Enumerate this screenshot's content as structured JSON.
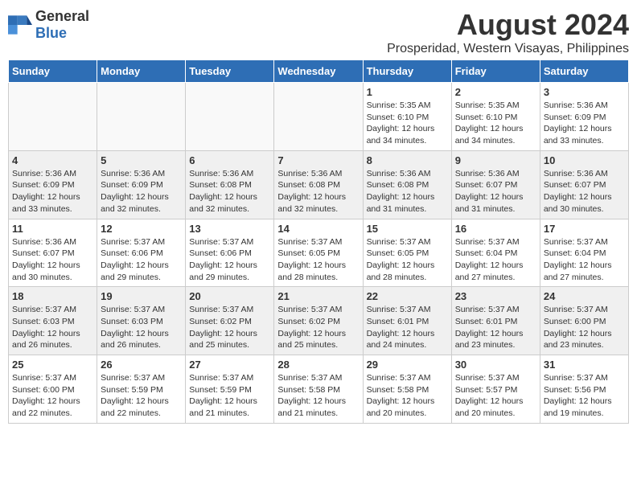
{
  "logo": {
    "text_general": "General",
    "text_blue": "Blue"
  },
  "title": "August 2024",
  "subtitle": "Prosperidad, Western Visayas, Philippines",
  "days_of_week": [
    "Sunday",
    "Monday",
    "Tuesday",
    "Wednesday",
    "Thursday",
    "Friday",
    "Saturday"
  ],
  "weeks": [
    [
      {
        "day": "",
        "info": ""
      },
      {
        "day": "",
        "info": ""
      },
      {
        "day": "",
        "info": ""
      },
      {
        "day": "",
        "info": ""
      },
      {
        "day": "1",
        "info": "Sunrise: 5:35 AM\nSunset: 6:10 PM\nDaylight: 12 hours\nand 34 minutes."
      },
      {
        "day": "2",
        "info": "Sunrise: 5:35 AM\nSunset: 6:10 PM\nDaylight: 12 hours\nand 34 minutes."
      },
      {
        "day": "3",
        "info": "Sunrise: 5:36 AM\nSunset: 6:09 PM\nDaylight: 12 hours\nand 33 minutes."
      }
    ],
    [
      {
        "day": "4",
        "info": "Sunrise: 5:36 AM\nSunset: 6:09 PM\nDaylight: 12 hours\nand 33 minutes."
      },
      {
        "day": "5",
        "info": "Sunrise: 5:36 AM\nSunset: 6:09 PM\nDaylight: 12 hours\nand 32 minutes."
      },
      {
        "day": "6",
        "info": "Sunrise: 5:36 AM\nSunset: 6:08 PM\nDaylight: 12 hours\nand 32 minutes."
      },
      {
        "day": "7",
        "info": "Sunrise: 5:36 AM\nSunset: 6:08 PM\nDaylight: 12 hours\nand 32 minutes."
      },
      {
        "day": "8",
        "info": "Sunrise: 5:36 AM\nSunset: 6:08 PM\nDaylight: 12 hours\nand 31 minutes."
      },
      {
        "day": "9",
        "info": "Sunrise: 5:36 AM\nSunset: 6:07 PM\nDaylight: 12 hours\nand 31 minutes."
      },
      {
        "day": "10",
        "info": "Sunrise: 5:36 AM\nSunset: 6:07 PM\nDaylight: 12 hours\nand 30 minutes."
      }
    ],
    [
      {
        "day": "11",
        "info": "Sunrise: 5:36 AM\nSunset: 6:07 PM\nDaylight: 12 hours\nand 30 minutes."
      },
      {
        "day": "12",
        "info": "Sunrise: 5:37 AM\nSunset: 6:06 PM\nDaylight: 12 hours\nand 29 minutes."
      },
      {
        "day": "13",
        "info": "Sunrise: 5:37 AM\nSunset: 6:06 PM\nDaylight: 12 hours\nand 29 minutes."
      },
      {
        "day": "14",
        "info": "Sunrise: 5:37 AM\nSunset: 6:05 PM\nDaylight: 12 hours\nand 28 minutes."
      },
      {
        "day": "15",
        "info": "Sunrise: 5:37 AM\nSunset: 6:05 PM\nDaylight: 12 hours\nand 28 minutes."
      },
      {
        "day": "16",
        "info": "Sunrise: 5:37 AM\nSunset: 6:04 PM\nDaylight: 12 hours\nand 27 minutes."
      },
      {
        "day": "17",
        "info": "Sunrise: 5:37 AM\nSunset: 6:04 PM\nDaylight: 12 hours\nand 27 minutes."
      }
    ],
    [
      {
        "day": "18",
        "info": "Sunrise: 5:37 AM\nSunset: 6:03 PM\nDaylight: 12 hours\nand 26 minutes."
      },
      {
        "day": "19",
        "info": "Sunrise: 5:37 AM\nSunset: 6:03 PM\nDaylight: 12 hours\nand 26 minutes."
      },
      {
        "day": "20",
        "info": "Sunrise: 5:37 AM\nSunset: 6:02 PM\nDaylight: 12 hours\nand 25 minutes."
      },
      {
        "day": "21",
        "info": "Sunrise: 5:37 AM\nSunset: 6:02 PM\nDaylight: 12 hours\nand 25 minutes."
      },
      {
        "day": "22",
        "info": "Sunrise: 5:37 AM\nSunset: 6:01 PM\nDaylight: 12 hours\nand 24 minutes."
      },
      {
        "day": "23",
        "info": "Sunrise: 5:37 AM\nSunset: 6:01 PM\nDaylight: 12 hours\nand 23 minutes."
      },
      {
        "day": "24",
        "info": "Sunrise: 5:37 AM\nSunset: 6:00 PM\nDaylight: 12 hours\nand 23 minutes."
      }
    ],
    [
      {
        "day": "25",
        "info": "Sunrise: 5:37 AM\nSunset: 6:00 PM\nDaylight: 12 hours\nand 22 minutes."
      },
      {
        "day": "26",
        "info": "Sunrise: 5:37 AM\nSunset: 5:59 PM\nDaylight: 12 hours\nand 22 minutes."
      },
      {
        "day": "27",
        "info": "Sunrise: 5:37 AM\nSunset: 5:59 PM\nDaylight: 12 hours\nand 21 minutes."
      },
      {
        "day": "28",
        "info": "Sunrise: 5:37 AM\nSunset: 5:58 PM\nDaylight: 12 hours\nand 21 minutes."
      },
      {
        "day": "29",
        "info": "Sunrise: 5:37 AM\nSunset: 5:58 PM\nDaylight: 12 hours\nand 20 minutes."
      },
      {
        "day": "30",
        "info": "Sunrise: 5:37 AM\nSunset: 5:57 PM\nDaylight: 12 hours\nand 20 minutes."
      },
      {
        "day": "31",
        "info": "Sunrise: 5:37 AM\nSunset: 5:56 PM\nDaylight: 12 hours\nand 19 minutes."
      }
    ]
  ]
}
